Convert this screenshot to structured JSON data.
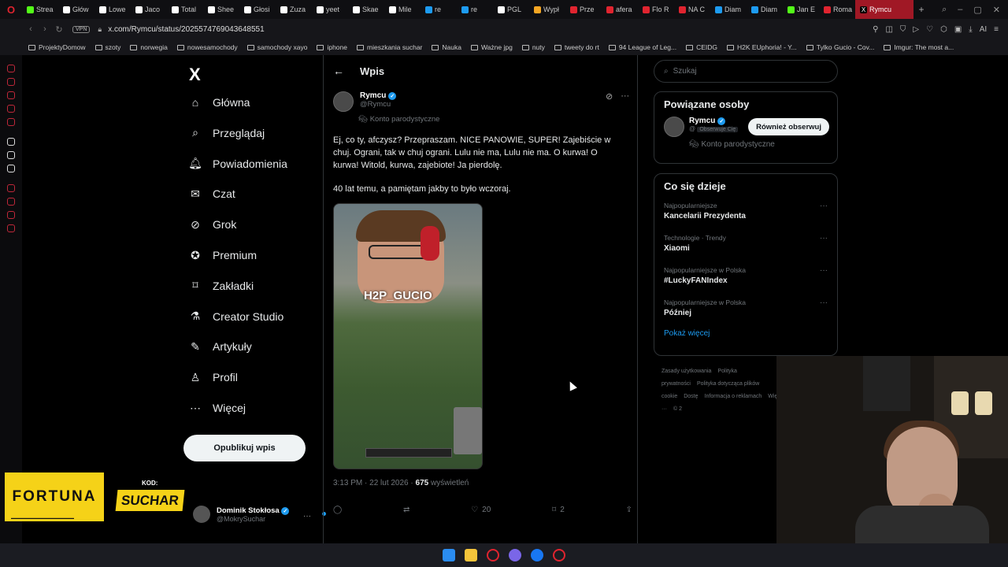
{
  "browser": {
    "tabs": [
      {
        "label": "Strea",
        "color": "#53fc18"
      },
      {
        "label": "Głów",
        "color": "#ffffff"
      },
      {
        "label": "Lowe",
        "color": "#ffffff"
      },
      {
        "label": "Jaco",
        "color": "#ffffff"
      },
      {
        "label": "Total",
        "color": "#ffffff"
      },
      {
        "label": "Shee",
        "color": "#ffffff"
      },
      {
        "label": "Głosi",
        "color": "#ffffff"
      },
      {
        "label": "Zuza",
        "color": "#ffffff"
      },
      {
        "label": "yeet",
        "color": "#ffffff"
      },
      {
        "label": "Skae",
        "color": "#ffffff"
      },
      {
        "label": "Mile",
        "color": "#ffffff"
      },
      {
        "label": "re",
        "color": "#1d9bf0"
      },
      {
        "label": "re",
        "color": "#1d9bf0"
      },
      {
        "label": "PGL",
        "color": "#ffffff"
      },
      {
        "label": "Wypł",
        "color": "#f5a623"
      },
      {
        "label": "Prze",
        "color": "#e0242f"
      },
      {
        "label": "afera",
        "color": "#e0242f"
      },
      {
        "label": "Flo R",
        "color": "#e0242f"
      },
      {
        "label": "NA C",
        "color": "#e0242f"
      },
      {
        "label": "Diam",
        "color": "#1d9bf0"
      },
      {
        "label": "Diam",
        "color": "#1d9bf0"
      },
      {
        "label": "Jan E",
        "color": "#53fc18"
      },
      {
        "label": "Roma",
        "color": "#e0242f"
      }
    ],
    "active_tab": "Rymcu",
    "url": "x.com/Rymcu/status/2025574769043648551",
    "vpn": "VPN",
    "bookmarks": [
      "ProjektyDomow",
      "szoty",
      "norwegia",
      "nowesamochody",
      "samochody xayo",
      "iphone",
      "mieszkania suchar",
      "Nauka",
      "Ważne jpg",
      "nuty",
      "tweety do rt",
      "94 League of Leg...",
      "CEIDG",
      "H2K EUphoria! - Y...",
      "Tylko Gucio - Cov...",
      "Imgur: The most a..."
    ]
  },
  "nav": {
    "logo": "X",
    "items": [
      {
        "label": "Główna",
        "icon": "home-icon",
        "glyph": "⌂"
      },
      {
        "label": "Przeglądaj",
        "icon": "search-icon",
        "glyph": "⌕"
      },
      {
        "label": "Powiadomienia",
        "icon": "bell-icon",
        "glyph": "🔔︎"
      },
      {
        "label": "Czat",
        "icon": "mail-icon",
        "glyph": "✉"
      },
      {
        "label": "Grok",
        "icon": "grok-icon",
        "glyph": "⊘"
      },
      {
        "label": "Premium",
        "icon": "premium-icon",
        "glyph": "✪"
      },
      {
        "label": "Zakładki",
        "icon": "bookmark-icon",
        "glyph": "⌑"
      },
      {
        "label": "Creator Studio",
        "icon": "flask-icon",
        "glyph": "⚗"
      },
      {
        "label": "Artykuły",
        "icon": "article-icon",
        "glyph": "✎"
      },
      {
        "label": "Profil",
        "icon": "profile-icon",
        "glyph": "♙"
      },
      {
        "label": "Więcej",
        "icon": "more-icon",
        "glyph": "⋯"
      }
    ],
    "post_button": "Opublikuj wpis",
    "account_name": "Dominik Stokłosa",
    "account_handle": "@MokrySuchar"
  },
  "promo": {
    "fortuna": "FORTUNA",
    "code_label": "KOD:",
    "code": "SUCHAR"
  },
  "post": {
    "header": "Wpis",
    "author_name": "Rymcu",
    "author_handle": "@Rymcu",
    "parody_label": "Konto parodystyczne",
    "text": "Ej, co ty, afczysz? Przepraszam. NICE PANOWIE, SUPER! Zajebiście w chuj. Ograni, tak w chuj ograni. Lulu nie ma, Lulu nie ma. O kurwa! O kurwa! Witold, kurwa, zajebiote! Ja pierdolę.",
    "text2": "40 lat temu, a pamiętam jakby to było wczoraj.",
    "media_watermark": "H2P_GUCIO",
    "time": "3:13 PM · 22 lut 2026 · ",
    "views_count": "675",
    "views_label": " wyświetleń",
    "likes": "20",
    "bookmarks": "2"
  },
  "sidebar": {
    "search_placeholder": "Szukaj",
    "related_title": "Powiązane osoby",
    "related_name": "Rymcu",
    "related_handle": "@",
    "related_follows": "Obserwuje Cię",
    "related_parody": "Konto parodystyczne",
    "follow_back": "Również obserwuj",
    "trends_title": "Co się dzieje",
    "trends": [
      {
        "context": "Najpopularniejsze",
        "name": "Kancelarii Prezydenta"
      },
      {
        "context": "Technologie · Trendy",
        "name": "Xiaomi"
      },
      {
        "context": "Najpopularniejsze w Polska",
        "name": "#LuckyFANIndex"
      },
      {
        "context": "Najpopularniejsze w Polska",
        "name": "Później"
      }
    ],
    "show_more": "Pokaż więcej",
    "footer": [
      "Zasady użytkowania",
      "Polityka prywatności",
      "Polityka dotycząca plików cookie",
      "Dostę",
      "Informacja o reklamach",
      "Więcej ···",
      "© 2"
    ]
  }
}
